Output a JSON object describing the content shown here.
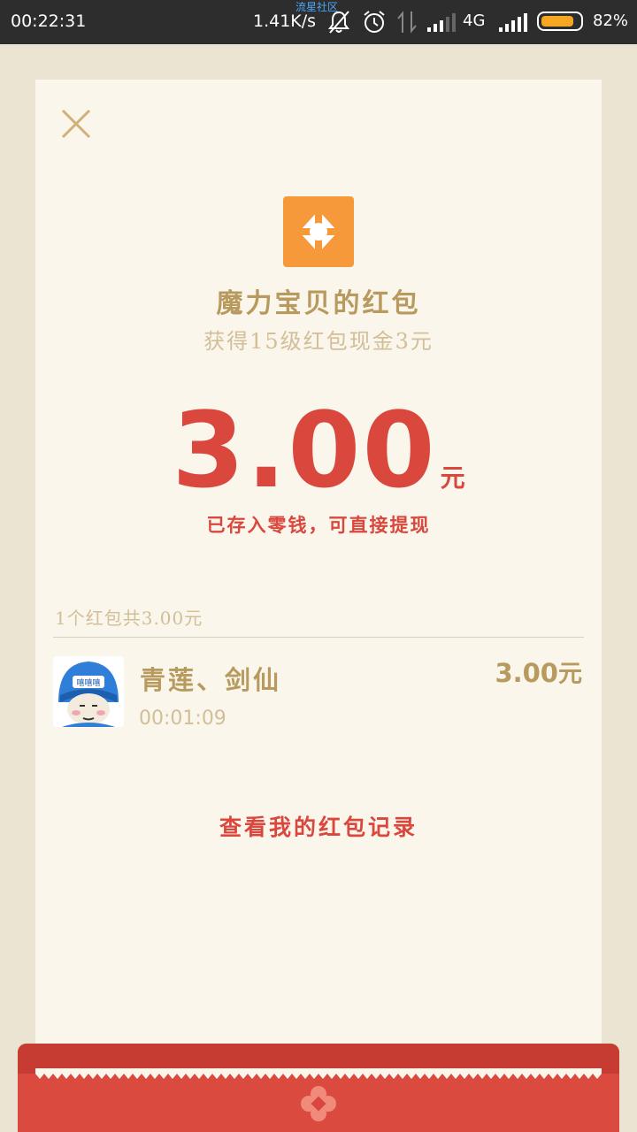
{
  "status_bar": {
    "time": "00:22:31",
    "watermark": "流星社区",
    "net_speed": "1.41K/s",
    "network_type": "4G",
    "battery_percent": "82%",
    "battery_level": 0.82,
    "icons": [
      "mute-bell-icon",
      "alarm-icon",
      "data-arrows-icon",
      "signal-icon",
      "signal-icon",
      "battery-icon"
    ]
  },
  "card": {
    "close_icon": "close-icon",
    "app_logo_icon": "app-logo-icon",
    "sender_title": "魔力宝贝的红包",
    "sender_subtitle": "获得15级红包现金3元",
    "amount": "3.00",
    "amount_unit": "元",
    "saved_note": "已存入零钱，可直接提现",
    "summary": "1个红包共3.00元",
    "records": [
      {
        "name": "青莲、剑仙",
        "time": "00:01:09",
        "amount": "3.00",
        "amount_unit": "元",
        "avatar_badge": "嘻嘻嘻"
      }
    ],
    "history_link": "查看我的红包记录"
  },
  "colors": {
    "accent_red": "#d9473d",
    "gold_text": "#b89a5e",
    "muted_text": "#d2be97",
    "card_bg": "#faf6ec",
    "page_bg": "#ece4d2",
    "logo_orange": "#f6993a"
  }
}
